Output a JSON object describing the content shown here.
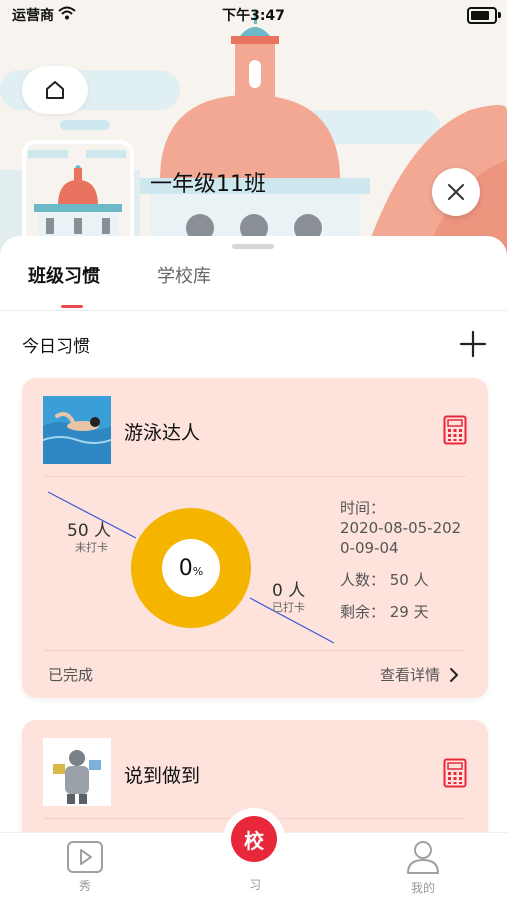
{
  "status_bar": {
    "carrier": "运营商",
    "time": "下午3:47"
  },
  "header": {
    "class_name": "一年级11班"
  },
  "tabs": [
    {
      "label": "班级习惯"
    },
    {
      "label": "学校库"
    }
  ],
  "section": {
    "title": "今日习惯"
  },
  "habits": [
    {
      "title": "游泳达人",
      "unchecked_count": "50 人",
      "unchecked_label": "未打卡",
      "checked_count": "0 人",
      "checked_label": "已打卡",
      "percent": "0",
      "percent_unit": "%",
      "time_label": "时间：",
      "time_value_1": "2020-08-05-202",
      "time_value_2": "0-09-04",
      "people": "人数：  50 人",
      "remaining": "剩余：  29 天",
      "status": "已完成",
      "details": "查看详情"
    },
    {
      "title": "说到做到"
    }
  ],
  "bottom_nav": [
    {
      "label": "秀"
    },
    {
      "label": "习",
      "badge": "校"
    },
    {
      "label": "我的"
    }
  ],
  "colors": {
    "accent": "#e8283a",
    "donut": "#f5b400",
    "card": "#fde3dc"
  }
}
